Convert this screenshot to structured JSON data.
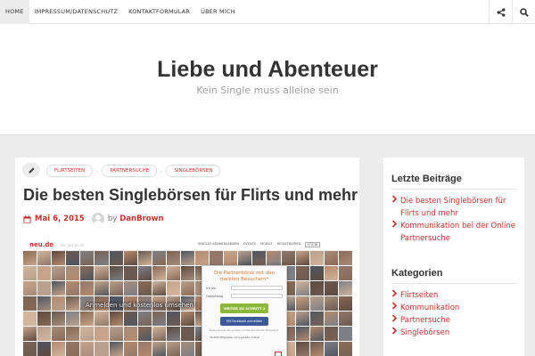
{
  "topnav": {
    "items": [
      {
        "label": "Home",
        "active": true
      },
      {
        "label": "Impressum/Datenschutz",
        "active": false
      },
      {
        "label": "Kontaktformular",
        "active": false
      },
      {
        "label": "Über mich",
        "active": false
      }
    ],
    "share_icon": "share-icon",
    "search_icon": "search-icon"
  },
  "site": {
    "title": "Liebe und Abenteuer",
    "description": "Kein Single muss alleine sein"
  },
  "post": {
    "edit_icon": "pencil-icon",
    "tags": [
      "Flirtseiten",
      "Partnersuche",
      "Singlebörsen"
    ],
    "tag_separator": "-",
    "title": "Die besten Singlebörsen für Flirts und mehr",
    "date": "Mai 6, 2015",
    "by": "by",
    "author": "DanBrown",
    "image": {
      "logo": "neu.de",
      "logo_tagline": "Sei gut zu dir",
      "nav": [
        "SINGLES KENNENLERNEN",
        "EVENTS",
        "MOBILE",
        "REGISTRIEREN",
        "LOGIN"
      ],
      "overlay_text": "Anmelden und kostenlos umsehen!",
      "signup_headline": "Die Partnerbörse mit den meisten Besuchern*",
      "signup_rows": [
        {
          "label": "Ich bin",
          "value": ""
        },
        {
          "label": "Geburtstag",
          "value": ""
        }
      ],
      "cta": "WEITER ZU SCHRITT 2",
      "facebook": "Mit Facebook anmelden",
      "small_print": "Keine Sorge, wir posten nichts auf deiner Pinnwand.",
      "members": "16.000 Mitglieder sind gerade online!"
    }
  },
  "sidebar": {
    "recent": {
      "title": "Letzte Beiträge",
      "items": [
        "Die besten Singlebörsen für Flirts und mehr",
        "Kommunikation bei der Online Partnersuche"
      ]
    },
    "categories": {
      "title": "Kategorien",
      "items": [
        "Flirtseiten",
        "Kommunikation",
        "Partnersuche",
        "Singlebörsen"
      ]
    }
  },
  "colors": {
    "accent": "#c9302c",
    "background": "#ececec",
    "cta_green": "#8cb83a",
    "facebook_blue": "#3b5998"
  }
}
